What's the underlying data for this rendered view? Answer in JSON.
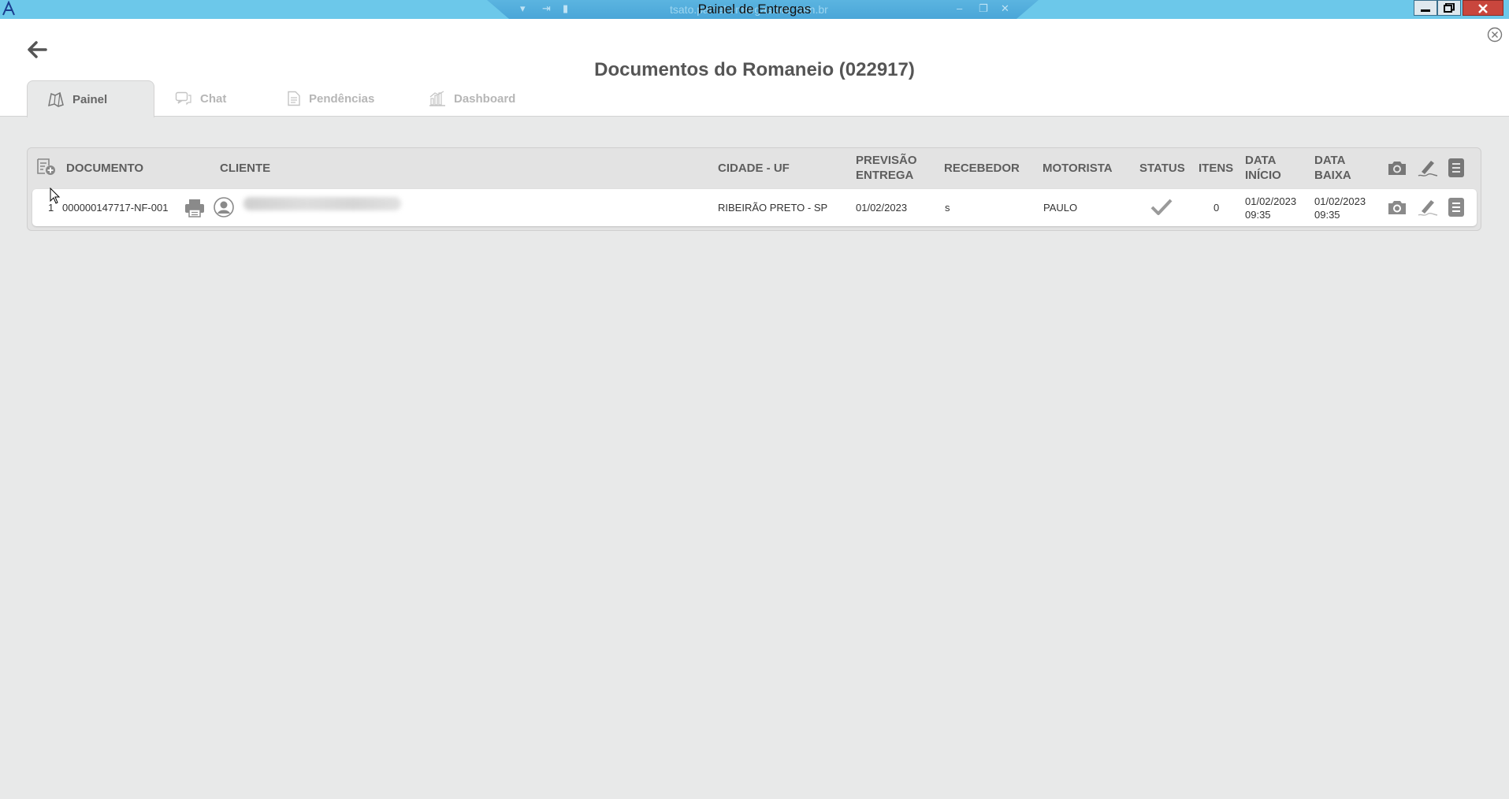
{
  "window": {
    "title": "Painel de Entregas",
    "remote_url": "tsato.painel.entregas.bre.com.br"
  },
  "page": {
    "title": "Documentos do Romaneio (022917)"
  },
  "tabs": [
    {
      "label": "Painel",
      "icon": "map-icon",
      "active": true
    },
    {
      "label": "Chat",
      "icon": "chat-icon",
      "active": false
    },
    {
      "label": "Pendências",
      "icon": "document-icon",
      "active": false
    },
    {
      "label": "Dashboard",
      "icon": "bar-chart-icon",
      "active": false
    }
  ],
  "table": {
    "headers": {
      "documento": "DOCUMENTO",
      "cliente": "CLIENTE",
      "cidade_uf": "CIDADE - UF",
      "previsao_1": "PREVISÃO",
      "previsao_2": "ENTREGA",
      "recebedor": "RECEBEDOR",
      "motorista": "MOTORISTA",
      "status": "STATUS",
      "itens": "ITENS",
      "data_inicio_1": "DATA",
      "data_inicio_2": "INÍCIO",
      "data_baixa_1": "DATA",
      "data_baixa_2": "BAIXA"
    },
    "rows": [
      {
        "index": "1",
        "documento": "000000147717-NF-001",
        "cidade_uf": "RIBEIRÃO PRETO - SP",
        "previsao_entrega": "01/02/2023",
        "recebedor": "s",
        "motorista": "PAULO",
        "status": "delivered-check",
        "itens": "0",
        "data_inicio_date": "01/02/2023",
        "data_inicio_time": "09:35",
        "data_baixa_date": "01/02/2023",
        "data_baixa_time": "09:35"
      }
    ]
  },
  "colors": {
    "titlebar": "#6cc8ea",
    "background": "#e8e9e9",
    "header_bg": "#ffffff",
    "title_text": "#555555",
    "icon_gray": "#8a8a8a"
  }
}
